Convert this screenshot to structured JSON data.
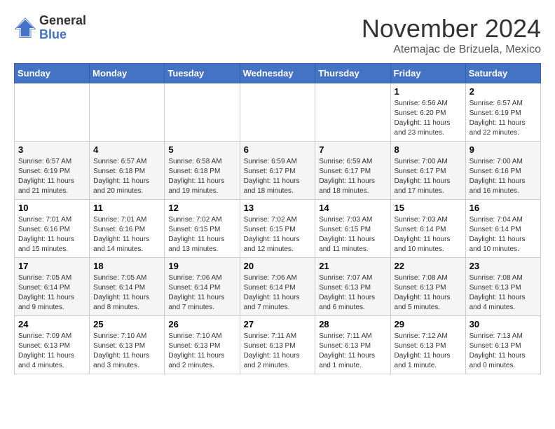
{
  "logo": {
    "general": "General",
    "blue": "Blue"
  },
  "header": {
    "month": "November 2024",
    "location": "Atemajac de Brizuela, Mexico"
  },
  "days_of_week": [
    "Sunday",
    "Monday",
    "Tuesday",
    "Wednesday",
    "Thursday",
    "Friday",
    "Saturday"
  ],
  "weeks": [
    [
      {
        "day": "",
        "info": ""
      },
      {
        "day": "",
        "info": ""
      },
      {
        "day": "",
        "info": ""
      },
      {
        "day": "",
        "info": ""
      },
      {
        "day": "",
        "info": ""
      },
      {
        "day": "1",
        "info": "Sunrise: 6:56 AM\nSunset: 6:20 PM\nDaylight: 11 hours and 23 minutes."
      },
      {
        "day": "2",
        "info": "Sunrise: 6:57 AM\nSunset: 6:19 PM\nDaylight: 11 hours and 22 minutes."
      }
    ],
    [
      {
        "day": "3",
        "info": "Sunrise: 6:57 AM\nSunset: 6:19 PM\nDaylight: 11 hours and 21 minutes."
      },
      {
        "day": "4",
        "info": "Sunrise: 6:57 AM\nSunset: 6:18 PM\nDaylight: 11 hours and 20 minutes."
      },
      {
        "day": "5",
        "info": "Sunrise: 6:58 AM\nSunset: 6:18 PM\nDaylight: 11 hours and 19 minutes."
      },
      {
        "day": "6",
        "info": "Sunrise: 6:59 AM\nSunset: 6:17 PM\nDaylight: 11 hours and 18 minutes."
      },
      {
        "day": "7",
        "info": "Sunrise: 6:59 AM\nSunset: 6:17 PM\nDaylight: 11 hours and 18 minutes."
      },
      {
        "day": "8",
        "info": "Sunrise: 7:00 AM\nSunset: 6:17 PM\nDaylight: 11 hours and 17 minutes."
      },
      {
        "day": "9",
        "info": "Sunrise: 7:00 AM\nSunset: 6:16 PM\nDaylight: 11 hours and 16 minutes."
      }
    ],
    [
      {
        "day": "10",
        "info": "Sunrise: 7:01 AM\nSunset: 6:16 PM\nDaylight: 11 hours and 15 minutes."
      },
      {
        "day": "11",
        "info": "Sunrise: 7:01 AM\nSunset: 6:16 PM\nDaylight: 11 hours and 14 minutes."
      },
      {
        "day": "12",
        "info": "Sunrise: 7:02 AM\nSunset: 6:15 PM\nDaylight: 11 hours and 13 minutes."
      },
      {
        "day": "13",
        "info": "Sunrise: 7:02 AM\nSunset: 6:15 PM\nDaylight: 11 hours and 12 minutes."
      },
      {
        "day": "14",
        "info": "Sunrise: 7:03 AM\nSunset: 6:15 PM\nDaylight: 11 hours and 11 minutes."
      },
      {
        "day": "15",
        "info": "Sunrise: 7:03 AM\nSunset: 6:14 PM\nDaylight: 11 hours and 10 minutes."
      },
      {
        "day": "16",
        "info": "Sunrise: 7:04 AM\nSunset: 6:14 PM\nDaylight: 11 hours and 10 minutes."
      }
    ],
    [
      {
        "day": "17",
        "info": "Sunrise: 7:05 AM\nSunset: 6:14 PM\nDaylight: 11 hours and 9 minutes."
      },
      {
        "day": "18",
        "info": "Sunrise: 7:05 AM\nSunset: 6:14 PM\nDaylight: 11 hours and 8 minutes."
      },
      {
        "day": "19",
        "info": "Sunrise: 7:06 AM\nSunset: 6:14 PM\nDaylight: 11 hours and 7 minutes."
      },
      {
        "day": "20",
        "info": "Sunrise: 7:06 AM\nSunset: 6:14 PM\nDaylight: 11 hours and 7 minutes."
      },
      {
        "day": "21",
        "info": "Sunrise: 7:07 AM\nSunset: 6:13 PM\nDaylight: 11 hours and 6 minutes."
      },
      {
        "day": "22",
        "info": "Sunrise: 7:08 AM\nSunset: 6:13 PM\nDaylight: 11 hours and 5 minutes."
      },
      {
        "day": "23",
        "info": "Sunrise: 7:08 AM\nSunset: 6:13 PM\nDaylight: 11 hours and 4 minutes."
      }
    ],
    [
      {
        "day": "24",
        "info": "Sunrise: 7:09 AM\nSunset: 6:13 PM\nDaylight: 11 hours and 4 minutes."
      },
      {
        "day": "25",
        "info": "Sunrise: 7:10 AM\nSunset: 6:13 PM\nDaylight: 11 hours and 3 minutes."
      },
      {
        "day": "26",
        "info": "Sunrise: 7:10 AM\nSunset: 6:13 PM\nDaylight: 11 hours and 2 minutes."
      },
      {
        "day": "27",
        "info": "Sunrise: 7:11 AM\nSunset: 6:13 PM\nDaylight: 11 hours and 2 minutes."
      },
      {
        "day": "28",
        "info": "Sunrise: 7:11 AM\nSunset: 6:13 PM\nDaylight: 11 hours and 1 minute."
      },
      {
        "day": "29",
        "info": "Sunrise: 7:12 AM\nSunset: 6:13 PM\nDaylight: 11 hours and 1 minute."
      },
      {
        "day": "30",
        "info": "Sunrise: 7:13 AM\nSunset: 6:13 PM\nDaylight: 11 hours and 0 minutes."
      }
    ]
  ]
}
